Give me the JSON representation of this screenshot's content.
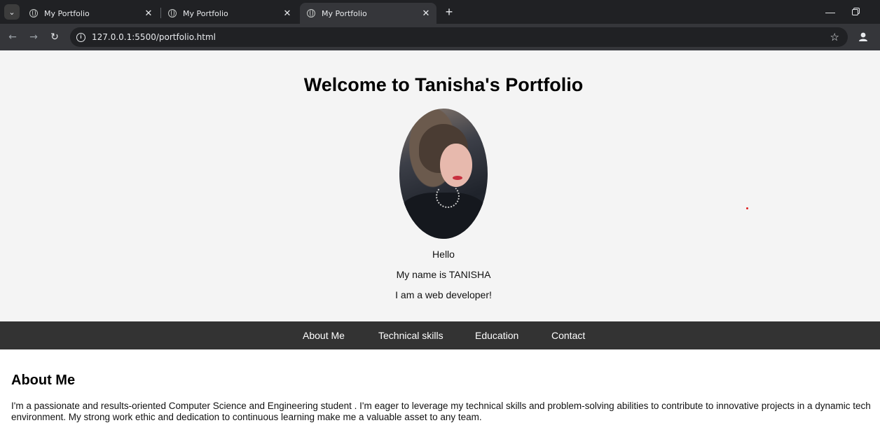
{
  "browser": {
    "tabs": [
      {
        "title": "My Portfolio",
        "active": false
      },
      {
        "title": "My Portfolio",
        "active": false
      },
      {
        "title": "My Portfolio",
        "active": true
      }
    ],
    "url": "127.0.0.1:5500/portfolio.html",
    "icons": {
      "tab_search": "chevron-down-icon",
      "favicon": "globe-icon",
      "close": "close-icon",
      "new_tab": "plus-icon",
      "back": "back-arrow-icon",
      "forward": "forward-arrow-icon",
      "reload": "reload-icon",
      "site_info": "info-icon",
      "bookmark": "star-icon",
      "profile": "profile-icon",
      "minimize": "minimize-icon",
      "restore": "restore-icon"
    }
  },
  "hero": {
    "title": "Welcome to Tanisha's Portfolio",
    "greeting": "Hello",
    "name_line": "My name is TANISHA",
    "role_line": "I am a web developer!"
  },
  "nav": {
    "items": [
      "About Me",
      "Technical skills",
      "Education",
      "Contact"
    ]
  },
  "about": {
    "heading": "About Me",
    "text": "I'm a passionate and results-oriented Computer Science and Engineering student . I'm eager to leverage my technical skills and problem-solving abilities to contribute to innovative projects in a dynamic tech environment. My strong work ethic and dedication to continuous learning make me a valuable asset to any team."
  },
  "colors": {
    "hero_bg": "#f4f4f4",
    "navbar_bg": "#333333",
    "chrome_dark": "#202124",
    "chrome_toolbar": "#35363a"
  }
}
